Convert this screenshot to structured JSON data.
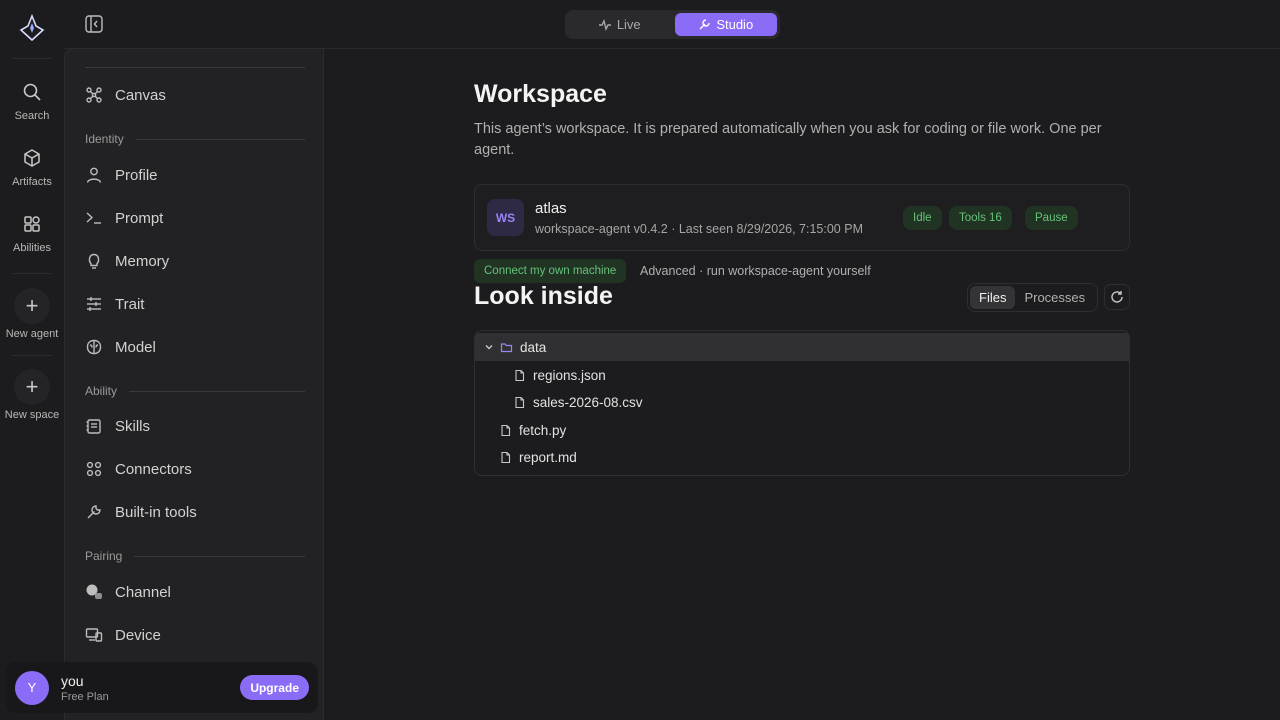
{
  "rail": {
    "items": [
      {
        "label": "Search",
        "icon": "search-icon"
      },
      {
        "label": "Artifacts",
        "icon": "cube-icon"
      },
      {
        "label": "Abilities",
        "icon": "grid-icon"
      },
      {
        "label": "New agent",
        "icon": "plus-icon"
      },
      {
        "label": "New space",
        "icon": "plus-icon"
      }
    ]
  },
  "modes": {
    "live": "Live",
    "studio": "Studio"
  },
  "panel": {
    "canvas": "Canvas",
    "sections": {
      "identity": "Identity",
      "ability": "Ability",
      "pairing": "Pairing"
    },
    "identity_items": [
      "Profile",
      "Prompt",
      "Memory",
      "Trait",
      "Model"
    ],
    "ability_items": [
      "Skills",
      "Connectors",
      "Built-in tools"
    ],
    "pairing_items": [
      "Channel",
      "Device"
    ]
  },
  "user": {
    "initial": "Y",
    "name": "you",
    "plan": "Free Plan",
    "upgrade": "Upgrade"
  },
  "main": {
    "title": "Workspace",
    "description": "This agent’s workspace. It is prepared automatically when you ask for coding or file work. One per agent.",
    "workspace": {
      "badge": "WS",
      "name": "atlas",
      "meta": "workspace-agent v0.4.2 · Last seen 8/29/2026, 7:15:00 PM",
      "status": "Idle",
      "tools": "Tools 16",
      "pause": "Pause"
    },
    "connect_label": "Connect my own machine",
    "advanced_label": "Advanced · run workspace-agent yourself",
    "look_title": "Look inside",
    "tabs": {
      "files": "Files",
      "processes": "Processes"
    },
    "tree": [
      {
        "name": "data",
        "type": "folder",
        "depth": 0,
        "expanded": true
      },
      {
        "name": "regions.json",
        "type": "file",
        "depth": 1
      },
      {
        "name": "sales-2026-08.csv",
        "type": "file",
        "depth": 1
      },
      {
        "name": "fetch.py",
        "type": "file",
        "depth": 0
      },
      {
        "name": "report.md",
        "type": "file",
        "depth": 0
      }
    ]
  },
  "colors": {
    "accent": "#8b6cf6",
    "status_green": "#66c27a",
    "status_bg": "#213323"
  }
}
